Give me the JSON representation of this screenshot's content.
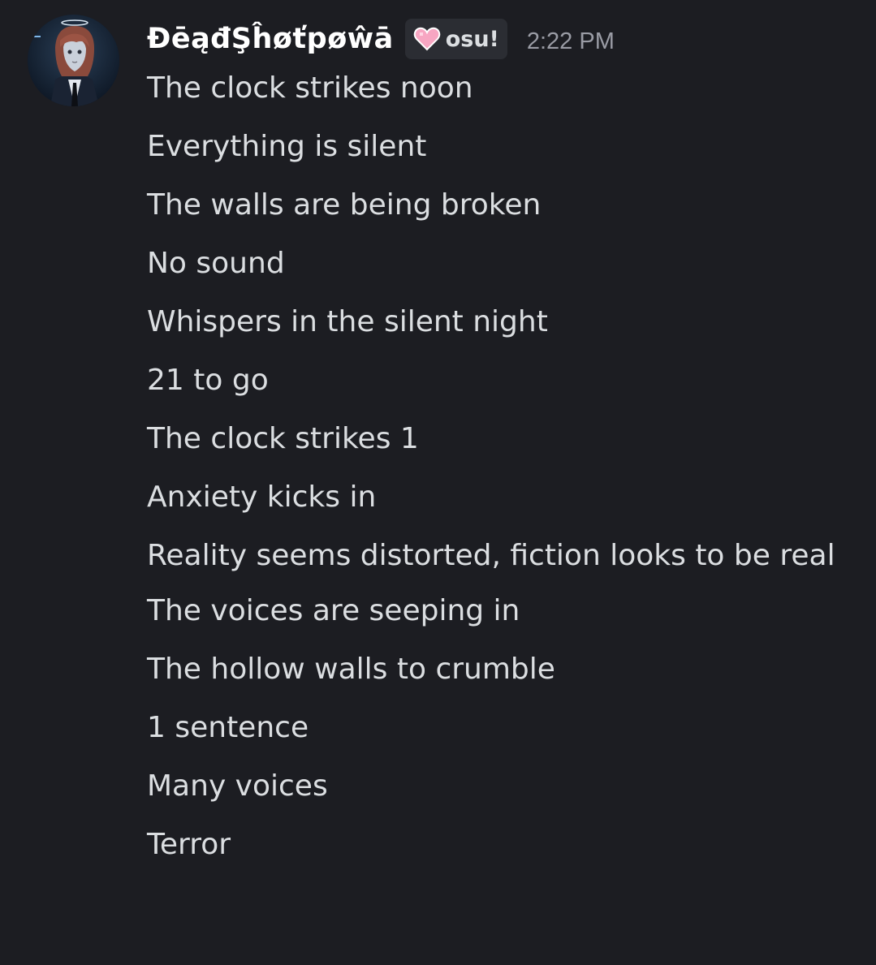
{
  "author": {
    "username": "ĐēąđŞĥøťpøŵā",
    "clan_tag": "osu!",
    "timestamp": "2:22 PM",
    "avatar_icon": "anime-character-avatar",
    "badge_icon": "heart-icon"
  },
  "message": {
    "lines": [
      "The clock strikes noon",
      "Everything is silent",
      "The walls are being broken",
      "No sound",
      "Whispers in the silent night",
      "21 to go",
      "The clock strikes 1",
      "Anxiety kicks in",
      "Reality seems distorted, fiction looks to be real",
      "The voices are seeping in",
      "The hollow walls to crumble",
      "1 sentence",
      "Many voices",
      "Terror"
    ]
  },
  "colors": {
    "background": "#1c1d22",
    "text": "#dbdee1",
    "username": "#ffffff",
    "timestamp": "#9a9ca5",
    "tag_background": "#2b2d33",
    "heart": "#f7a6c2"
  }
}
